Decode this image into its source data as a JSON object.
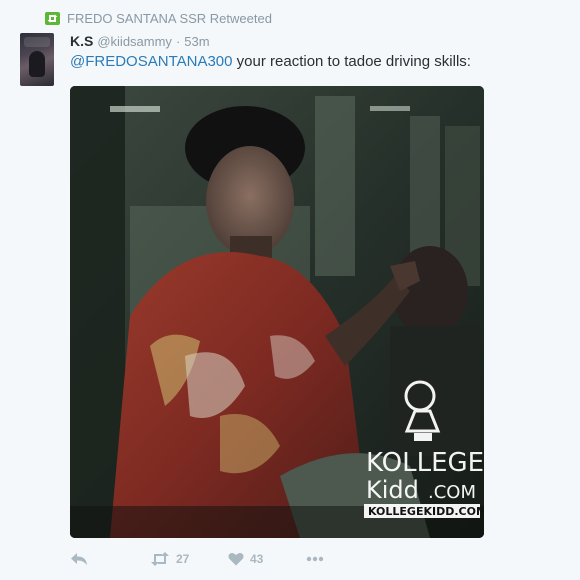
{
  "retweet_context": {
    "icon": "retweet-icon",
    "text": "FREDO SANTANA SSR Retweeted",
    "badge_color": "#5fb636"
  },
  "tweet": {
    "author_name": "K.S",
    "author_handle": "@kiidsammy",
    "separator": "·",
    "timestamp": "53m",
    "mention": "@FREDOSANTANA300",
    "body": " your reaction to tadoe driving skills:",
    "mention_color": "#2b7bb9"
  },
  "media": {
    "watermark_logo_text_1": "KOLLEGE",
    "watermark_logo_text_2": "Kidd",
    "watermark_logo_text_3": ".COM",
    "watermark_url": "KOLLEGEKIDD.COM"
  },
  "actions": {
    "reply_icon": "reply-icon",
    "retweet_icon": "retweet-icon",
    "retweet_count": "27",
    "like_icon": "heart-icon",
    "like_count": "43",
    "more_icon": "more-icon"
  }
}
